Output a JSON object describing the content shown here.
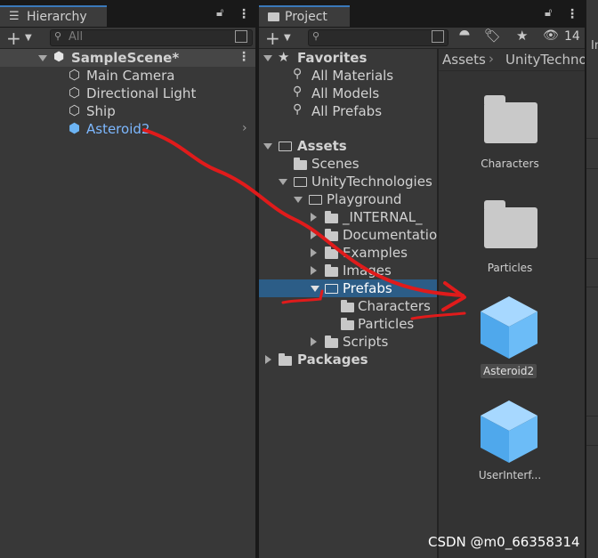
{
  "hierarchy": {
    "tab_label": "Hierarchy",
    "search_placeholder": "All",
    "scene_name": "SampleScene*",
    "objects": [
      {
        "label": "Main Camera",
        "icon": "cube-outline-icon"
      },
      {
        "label": "Directional Light",
        "icon": "cube-outline-icon"
      },
      {
        "label": "Ship",
        "icon": "cube-outline-icon"
      },
      {
        "label": "Asteroid2",
        "icon": "prefab-cube-icon",
        "color": "#7db8ff"
      }
    ]
  },
  "project": {
    "tab_label": "Project",
    "visibility_count": "14",
    "favorites": {
      "label": "Favorites",
      "items": [
        "All Materials",
        "All Models",
        "All Prefabs"
      ]
    },
    "assets_tree": {
      "assets_label": "Assets",
      "scenes_label": "Scenes",
      "unity_label": "UnityTechnologies",
      "playground_label": "Playground",
      "playground_children": [
        "_INTERNAL_",
        "Documentation",
        "Examples",
        "Images",
        "Prefabs",
        "Scripts"
      ],
      "prefabs_children": [
        "Characters",
        "Particles"
      ],
      "packages_label": "Packages"
    },
    "breadcrumb": [
      "Assets",
      "UnityTechno"
    ],
    "grid_items": [
      {
        "label": "Characters",
        "icon": "folder-icon"
      },
      {
        "label": "Particles",
        "icon": "folder-icon"
      },
      {
        "label": "Asteroid2",
        "icon": "prefab-cube-icon"
      },
      {
        "label": "UserInterf...",
        "icon": "prefab-cube-icon"
      }
    ]
  },
  "inspector_fragment": "In",
  "watermark": "CSDN @m0_66358314",
  "colors": {
    "accent": "#3a79bb",
    "selection": "#2c5d87",
    "prefab_blue": "#6cb4f4",
    "annotation_red": "#e01b1b"
  }
}
